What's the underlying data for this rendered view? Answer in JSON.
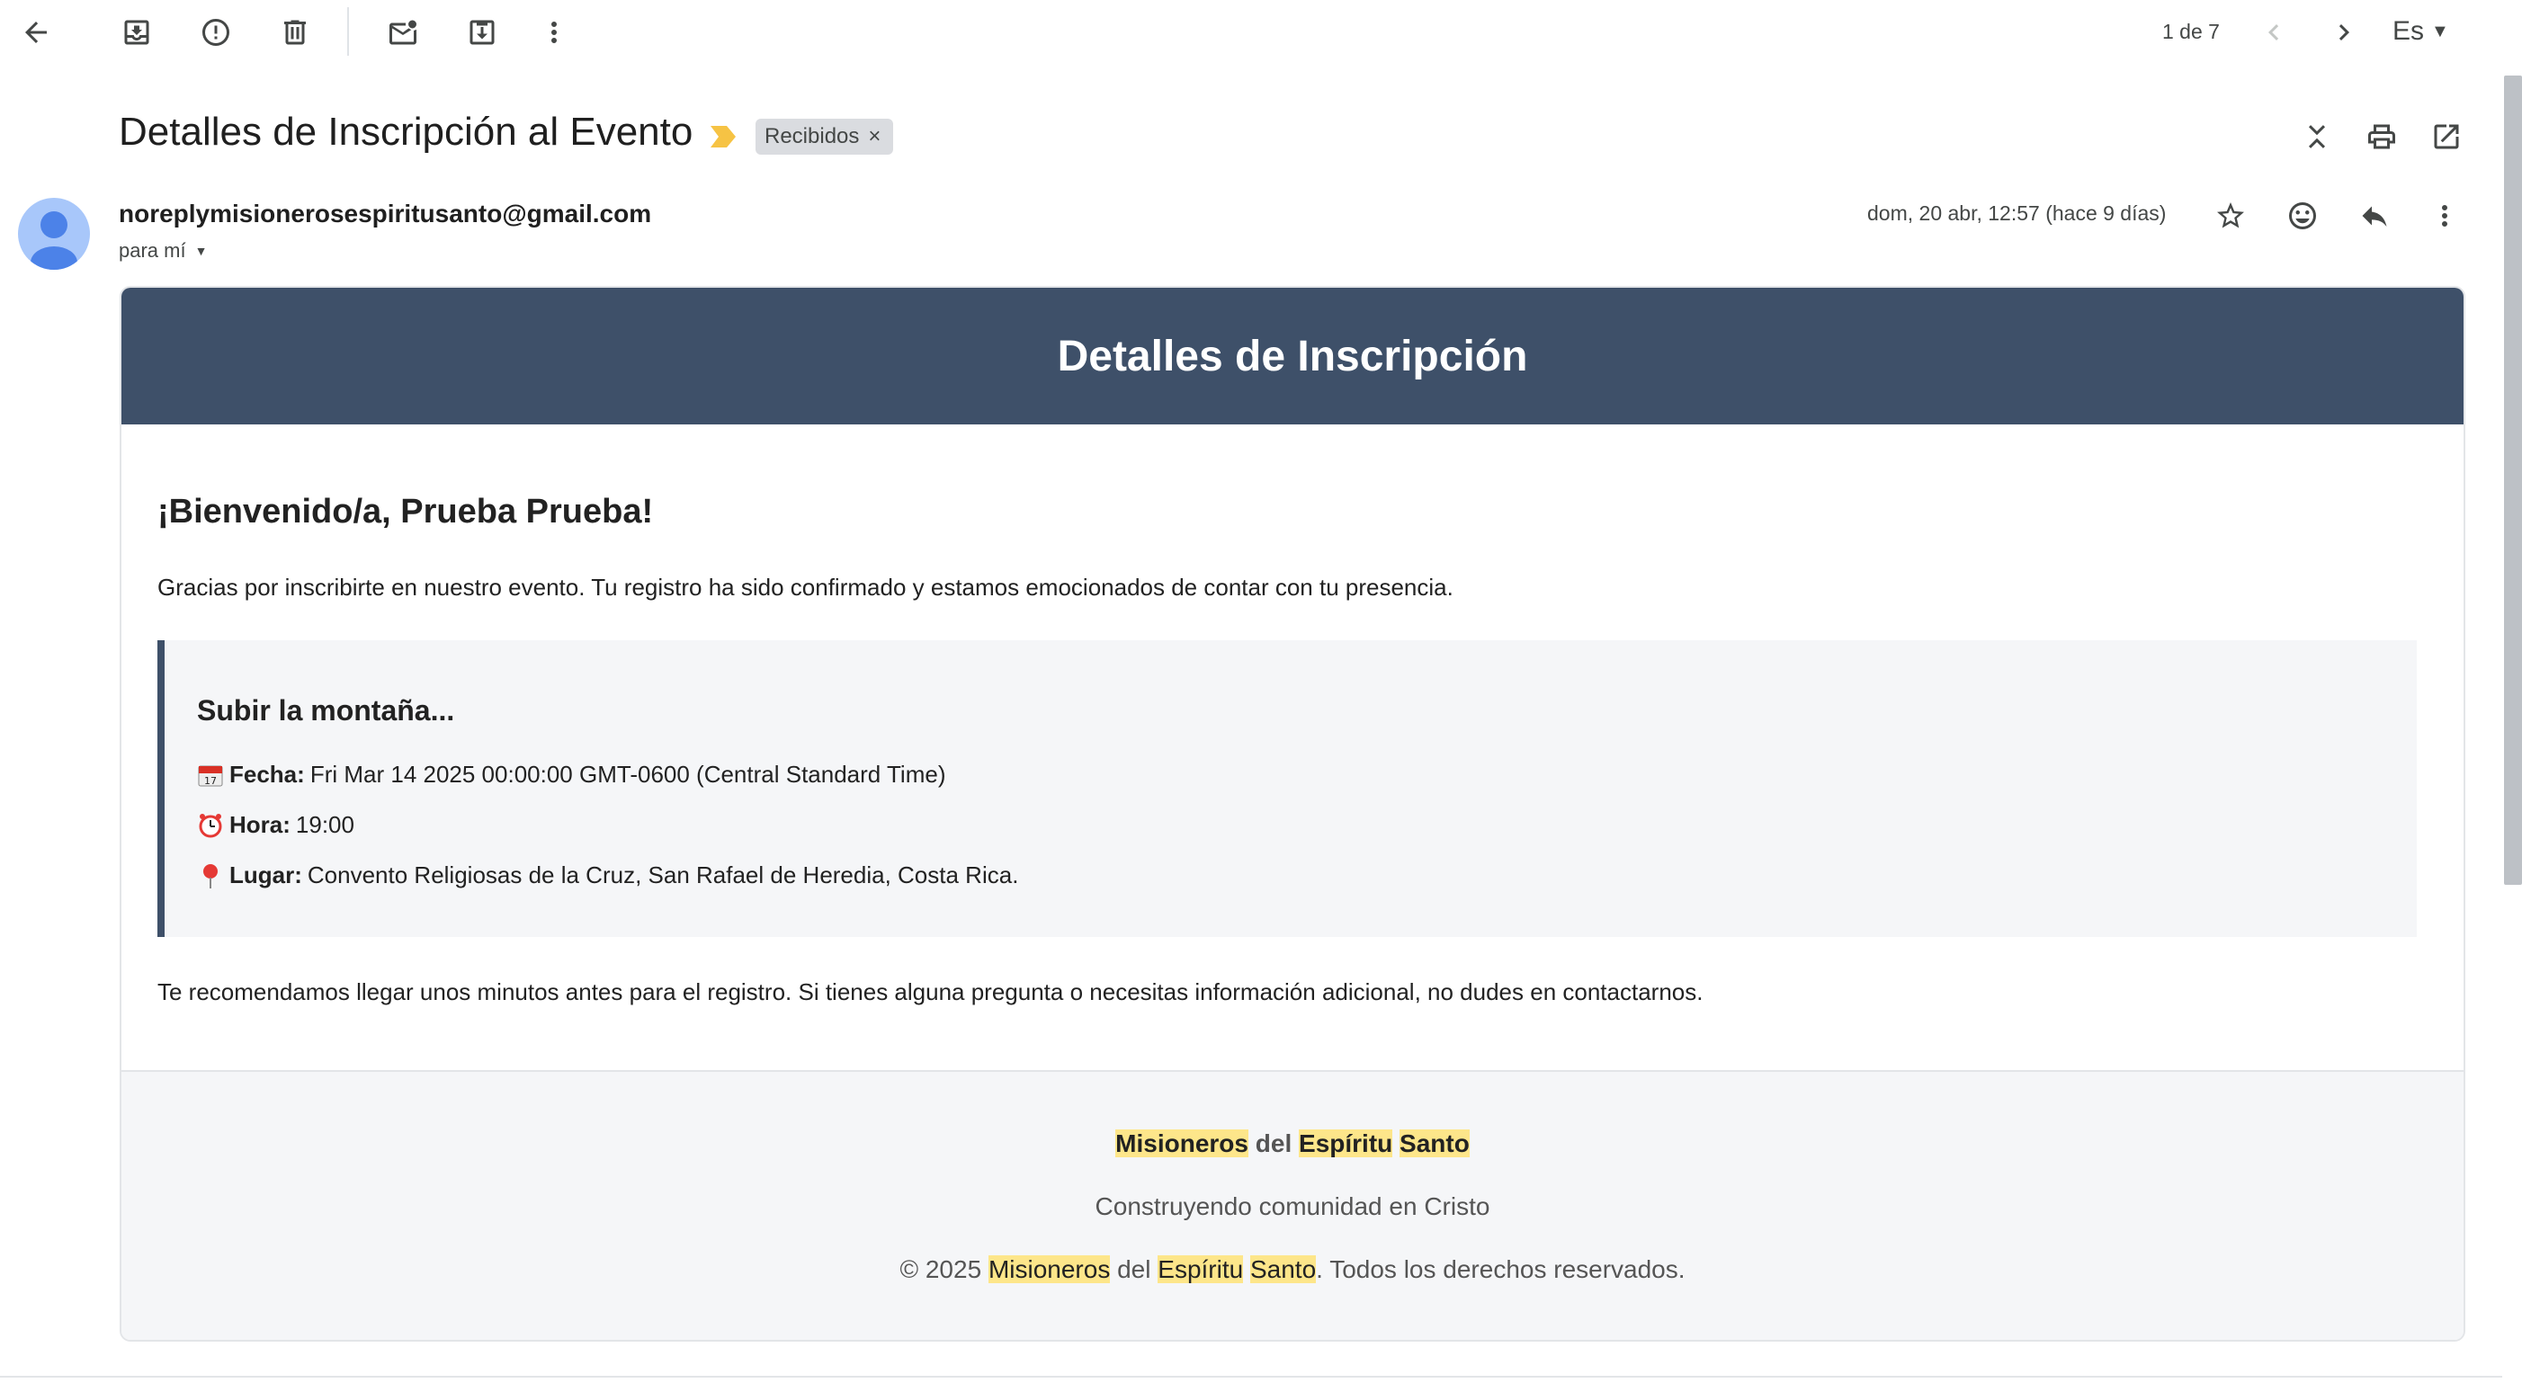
{
  "toolbar": {
    "icons": [
      "back-arrow-icon",
      "archive-icon",
      "report-spam-icon",
      "delete-icon",
      "mark-unread-icon",
      "move-to-icon",
      "more-vert-icon"
    ],
    "pager": "1 de 7",
    "lang": "Es"
  },
  "email": {
    "subject": "Detalles de Inscripción al Evento",
    "label": "Recibidos",
    "sender": "noreplymisionerosespiritusanto@gmail.com",
    "to": "para mí",
    "date": "dom, 20 abr, 12:57 (hace 9 días)"
  },
  "card": {
    "header_title": "Detalles de Inscripción",
    "welcome": "¡Bienvenido/a, Prueba Prueba!",
    "thanks": "Gracias por inscribirte en nuestro evento. Tu registro ha sido confirmado y estamos emocionados de contar con tu presencia.",
    "event": {
      "name": "Subir la montaña...",
      "date_label": "Fecha:",
      "date_value": "Fri Mar 14 2025 00:00:00 GMT-0600 (Central Standard Time)",
      "time_label": "Hora:",
      "time_value": "19:00",
      "place_label": "Lugar:",
      "place_value": "Convento Religiosas de la Cruz, San Rafael de Heredia, Costa Rica."
    },
    "recommend": "Te recomendamos llegar unos minutos antes para el registro. Si tienes alguna pregunta o necesitas información adicional, no dudes en contactarnos.",
    "footer": {
      "org_1": "Misioneros",
      "org_2": "del",
      "org_3": "Espíritu",
      "org_4": "Santo",
      "tagline": "Construyendo comunidad en Cristo",
      "copy_prefix": "© 2025",
      "copy_suffix": ". Todos los derechos reservados."
    }
  },
  "colors": {
    "header_bg": "#3e5069",
    "highlight": "#fde68a",
    "label_chip": "#dadce0"
  }
}
